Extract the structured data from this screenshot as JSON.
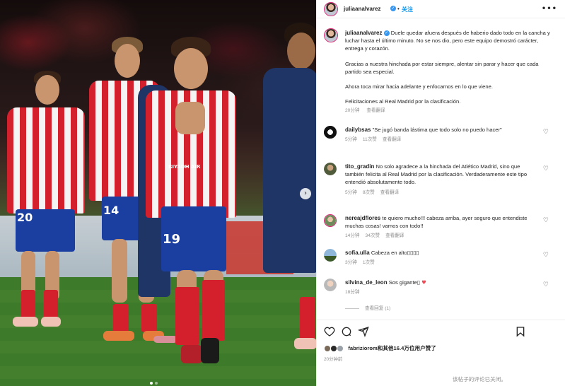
{
  "post": {
    "author": "juliaanalvarez",
    "follow_label": "关注",
    "more_icon": "more-horizontal-icon"
  },
  "caption": {
    "paragraphs": [
      "Duele quedar afuera después de haberio dado todo en la cancha y luchar hasta el último minuto. No se nos dio, pero este equipo demostró carácter, entrega y corazón.",
      "Gracias a nuestra hinchada por estar siempre, alentar sin parar y hacer que cada partido sea especial.",
      "Ahora toca mirar hacia adelante y enfocarnos en lo que viene.",
      "Felicitaciones al Real Madrid por la clasificación."
    ],
    "time": "20分钟",
    "translate": "查看翻译"
  },
  "comments": [
    {
      "user": "dailybsas",
      "text": "\"Se jugó banda lástima que todo solo no puedo hacer\"",
      "time": "5分钟",
      "likes": "11次赞",
      "translate": "查看翻译"
    },
    {
      "user": "tito_gradin",
      "text": "No solo agradece a la hinchada del Atlético Madrid, sino que también felicita al Real Madrid por la clasificación. Verdaderamente este tipo entendió absolutamente todo.",
      "time": "5分钟",
      "likes": "8次赞",
      "translate": "查看翻译"
    },
    {
      "user": "nereajdflores",
      "text": "te quiero mucho!!! cabeza arriba, ayer seguro que entendiste muchas cosas! vamos con todo!!",
      "time": "14分钟",
      "likes": "34次赞",
      "translate": "查看翻译"
    },
    {
      "user": "sofia.ulla",
      "text": "Cabeza en alto▯▯▯▯",
      "time": "3分钟",
      "likes": "1次赞",
      "translate": ""
    },
    {
      "user": "silvina_de_leon",
      "text": "Sos gigante▯",
      "time": "18分钟",
      "likes": "",
      "translate": ""
    }
  ],
  "view_replies": "查看回复 (1)",
  "likes": {
    "user": "fabriziorom",
    "rest": "和其他16.4万位用户赞了"
  },
  "date": "20分钟前",
  "comments_disabled": "该帖子的评论已关闭。",
  "photo": {
    "jersey_number": "19",
    "sponsor": "RIYADH AIR",
    "left_number": "20",
    "mid_number": "14"
  },
  "colors": {
    "accent": "#0095f6",
    "verified": "#3897f0",
    "heart": "#ed4956",
    "muted": "#8e8e8e"
  }
}
